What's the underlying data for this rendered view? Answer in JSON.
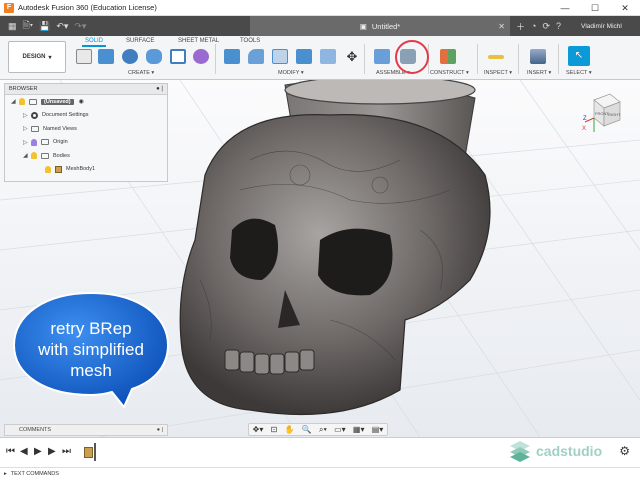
{
  "window": {
    "title": "Autodesk Fusion 360 (Education License)",
    "app_logo": "F",
    "controls": [
      "—",
      "☐",
      "✕"
    ]
  },
  "tabstrip": {
    "doc_title": "Untitled*",
    "close": "✕",
    "user": "Vladimír Michl"
  },
  "toolbar": {
    "workspace": "DESIGN",
    "tabs": [
      "SOLID",
      "SURFACE",
      "SHEET METAL",
      "TOOLS"
    ],
    "groups": {
      "create": "CREATE",
      "modify": "MODIFY",
      "assemble": "ASSEMBLE",
      "construct": "CONSTRUCT",
      "inspect": "INSPECT",
      "insert": "INSERT",
      "select": "SELECT"
    }
  },
  "browser": {
    "title": "BROWSER",
    "items": [
      {
        "label": "(Unsaved)"
      },
      {
        "label": "Document Settings"
      },
      {
        "label": "Named Views"
      },
      {
        "label": "Origin"
      },
      {
        "label": "Bodies"
      },
      {
        "label": "MeshBody1"
      }
    ]
  },
  "comments": {
    "label": "COMMENTS"
  },
  "bubble": {
    "line1": "retry BRep",
    "line2": "with simplified",
    "line3": "mesh"
  },
  "viewcube": {
    "face": "FRONT",
    "face2": "RIGHT",
    "axis_x": "X",
    "axis_z": "Z"
  },
  "statusbar": {
    "text_commands": "TEXT COMMANDS"
  },
  "watermark": {
    "text": "cadstudio"
  },
  "colors": {
    "accent": "#0696d7",
    "bubble": "#1a6fd8",
    "highlight": "#e33a4a"
  }
}
